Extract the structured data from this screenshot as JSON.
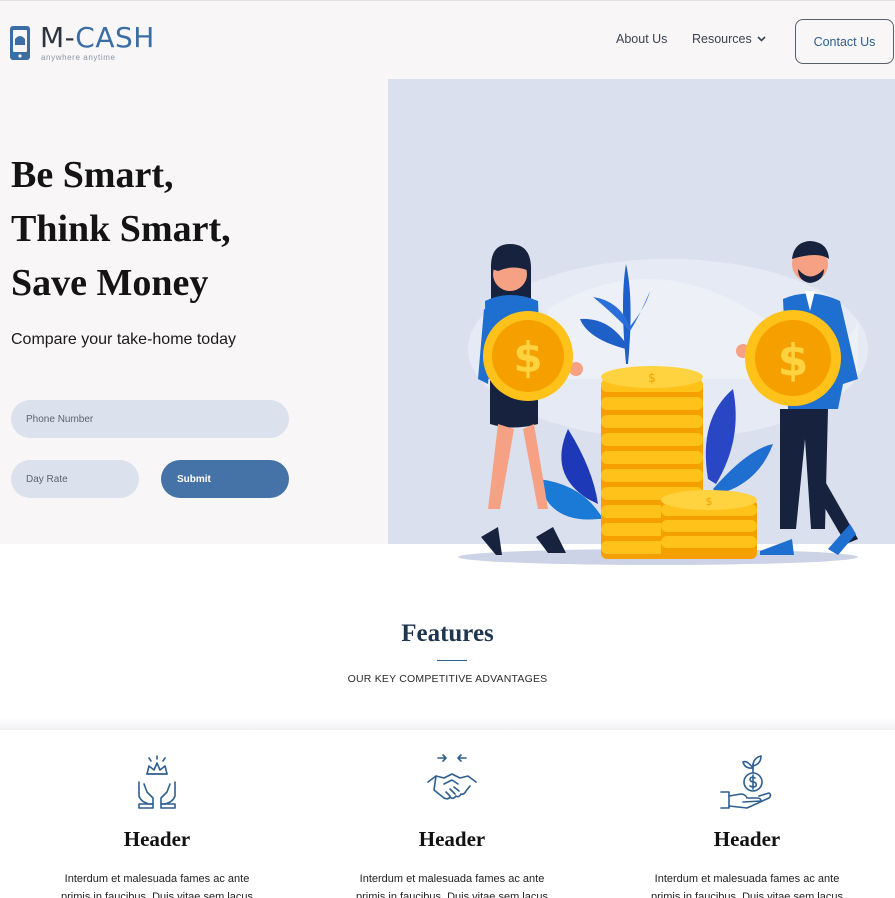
{
  "brand": {
    "name_part1": "M-",
    "name_part2": "CASH",
    "tagline": "anywhere anytime",
    "accent_color": "#3a6ea5"
  },
  "nav": {
    "about": "About Us",
    "resources": "Resources",
    "contact": "Contact Us"
  },
  "hero": {
    "headline_lines": [
      "Be Smart,",
      "Think Smart,",
      "Save Money"
    ],
    "subheading": "Compare your take-home today",
    "form": {
      "phone_placeholder": "Phone Number",
      "rate_placeholder": "Day Rate",
      "submit_label": "Submit"
    }
  },
  "features": {
    "title": "Features",
    "subtitle": "OUR KEY COMPETITIVE ADVANTAGES",
    "cards": [
      {
        "icon": "crown-hands-icon",
        "header": "Header",
        "text": "Interdum et malesuada fames ac ante primis in faucibus. Duis vitae sem lacus"
      },
      {
        "icon": "handshake-icon",
        "header": "Header",
        "text": "Interdum et malesuada fames ac ante primis in faucibus. Duis vitae sem lacus"
      },
      {
        "icon": "money-plant-hand-icon",
        "header": "Header",
        "text": "Interdum et malesuada fames ac ante primis in faucibus. Duis vitae sem lacus"
      }
    ]
  }
}
